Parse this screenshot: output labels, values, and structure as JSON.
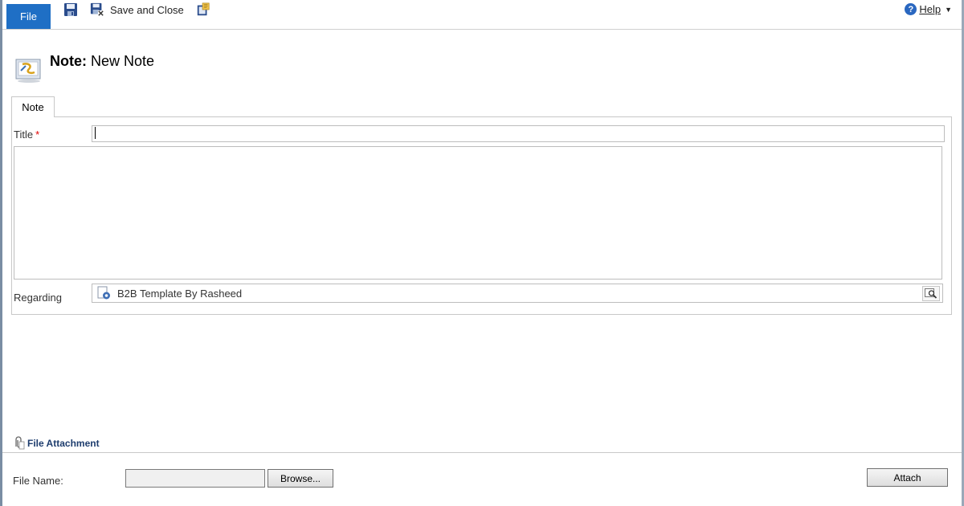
{
  "toolbar": {
    "file_label": "File",
    "save_and_close_label": "Save and Close",
    "help_label": "Help"
  },
  "header": {
    "entity_label": "Note:",
    "record_title": "New Note"
  },
  "tabs": [
    {
      "label": "Note"
    }
  ],
  "form": {
    "title_label": "Title",
    "title_required_marker": "*",
    "title_value": "",
    "body_value": "",
    "regarding_label": "Regarding",
    "regarding_value": "B2B Template By Rasheed"
  },
  "attachment": {
    "section_title": "File Attachment",
    "file_name_label": "File Name:",
    "file_name_value": "",
    "browse_label": "Browse...",
    "attach_label": "Attach"
  },
  "icons": {
    "save": "save-icon",
    "save_close": "save-and-close-icon",
    "third": "document-edit-icon",
    "help": "help-icon",
    "note_entity": "note-entity-icon",
    "lookup": "lookup-icon",
    "paperclip": "paperclip-icon"
  },
  "colors": {
    "file_button": "#1f6fc5",
    "required": "#e00000",
    "section_title": "#1e3d6e"
  }
}
